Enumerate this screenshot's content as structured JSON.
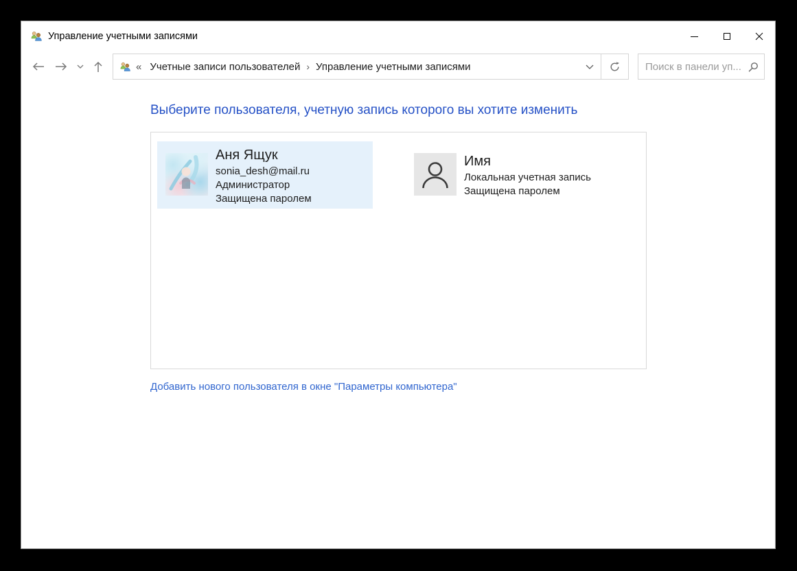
{
  "window": {
    "title": "Управление учетными записями"
  },
  "toolbar": {
    "breadcrumb": {
      "collapse_glyph": "«",
      "separator_glyph": "›",
      "items": [
        {
          "label": "Учетные записи пользователей"
        },
        {
          "label": "Управление учетными записями"
        }
      ]
    },
    "search": {
      "placeholder": "Поиск в панели уп..."
    }
  },
  "main": {
    "heading": "Выберите пользователя, учетную запись которого вы хотите изменить",
    "accounts": [
      {
        "name": "Аня Ящук",
        "email": "sonia_desh@mail.ru",
        "role": "Администратор",
        "protection": "Защищена паролем",
        "selected": true
      },
      {
        "name": "Имя",
        "type": "Локальная учетная запись",
        "protection": "Защищена паролем",
        "selected": false
      }
    ],
    "add_user_link": "Добавить нового пользователя в окне \"Параметры компьютера\""
  },
  "icons": {
    "app": "two-users-icon",
    "search": "magnifier-icon",
    "refresh": "refresh-icon",
    "placeholder_avatar": "person-outline-icon"
  },
  "colors": {
    "heading_blue": "#2551c6",
    "link_blue": "#3166cf",
    "selected_tile_bg": "#e5f1fb",
    "border_gray": "#d4d4d4",
    "desktop_bg": "#000000"
  }
}
